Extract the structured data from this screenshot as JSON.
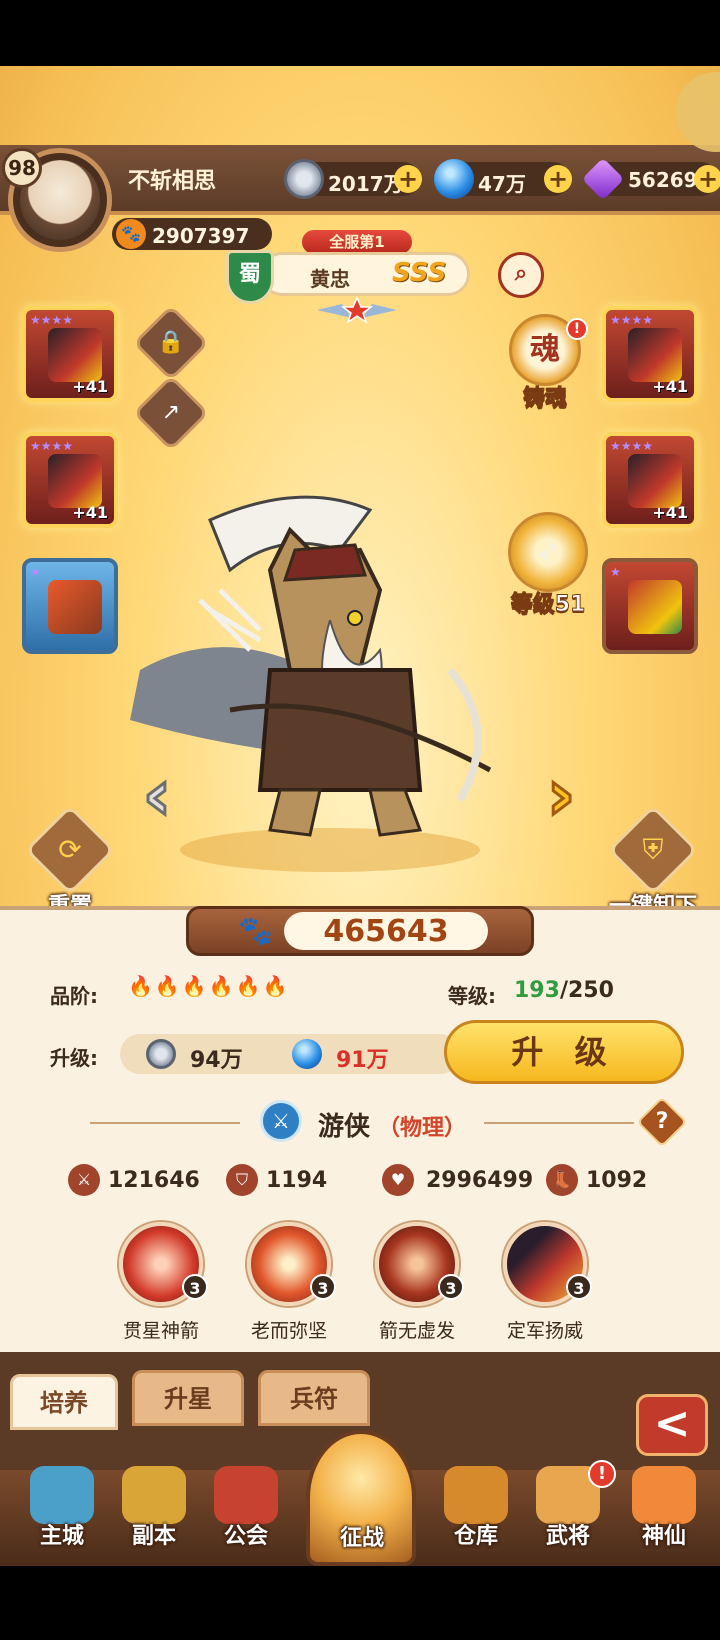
{
  "player": {
    "level": "98",
    "name": "不斩相思",
    "power": "2907397"
  },
  "resources": [
    {
      "icon": "silver-coin-icon",
      "value": "2017万",
      "plus": "+"
    },
    {
      "icon": "blue-orb-icon",
      "value": "47万",
      "plus": "+"
    },
    {
      "icon": "purple-gem-icon",
      "value": "56269",
      "plus": "+"
    }
  ],
  "hero": {
    "rank_tag": "全服第1",
    "faction": "蜀",
    "name": "黄忠",
    "grade": "SSS",
    "search_icon": "magnifier-icon"
  },
  "equipment": {
    "left": [
      {
        "plus": "+41",
        "stars": "★★★★"
      },
      {
        "plus": "+41",
        "stars": "★★★★"
      },
      {
        "plus": "",
        "stars": "★"
      }
    ],
    "right": [
      {
        "plus": "+41",
        "stars": "★★★★"
      },
      {
        "plus": "+41",
        "stars": "★★★★"
      },
      {
        "plus": "",
        "stars": "★"
      }
    ]
  },
  "features": {
    "forge_soul": "铸魂",
    "forge_badge": "!",
    "weapon_level": "等级51"
  },
  "actions": {
    "reset": "重置",
    "unequip_all": "一键卸下",
    "prev": "‹",
    "next": "›"
  },
  "combat_power": "465643",
  "details": {
    "quality_label": "品阶:",
    "quality_drops": "🔥🔥🔥🔥🔥🔥",
    "level_label": "等级:",
    "level_current": "193",
    "level_max": "/250",
    "upgrade_label": "升级:",
    "cost_silver": "94万",
    "cost_orb": "91万",
    "upgrade_button": "升 级"
  },
  "class": {
    "name": "游侠",
    "type": "（物理）",
    "help": "?"
  },
  "stats": [
    {
      "icon": "sword-icon",
      "value": "121646"
    },
    {
      "icon": "shield-icon",
      "value": "1194"
    },
    {
      "icon": "heart-icon",
      "value": "2996499"
    },
    {
      "icon": "boot-icon",
      "value": "1092"
    }
  ],
  "skills": [
    {
      "name": "贯星神箭",
      "level": "3",
      "color": "#d23a2a"
    },
    {
      "name": "老而弥坚",
      "level": "3",
      "color": "#e2572c"
    },
    {
      "name": "箭无虚发",
      "level": "3",
      "color": "#a8351f"
    },
    {
      "name": "定军扬威",
      "level": "3",
      "color": "#c1392b"
    }
  ],
  "tabs": [
    {
      "label": "培养",
      "active": true
    },
    {
      "label": "升星",
      "active": false
    },
    {
      "label": "兵符",
      "active": false
    }
  ],
  "back_button": "<",
  "nav": [
    {
      "label": "主城",
      "color": "#4aa0c9"
    },
    {
      "label": "副本",
      "color": "#d9a537"
    },
    {
      "label": "公会",
      "color": "#c8432f"
    },
    {
      "label": "征战",
      "color": "#f3b24b"
    },
    {
      "label": "仓库",
      "color": "#d68a2c"
    },
    {
      "label": "武将",
      "color": "#e8a64e"
    },
    {
      "label": "神仙",
      "color": "#f08a3a"
    }
  ],
  "nav_badge": "!"
}
